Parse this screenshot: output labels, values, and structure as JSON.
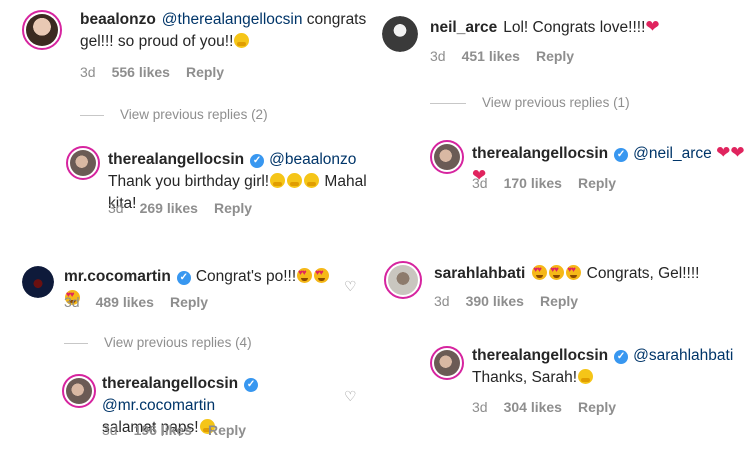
{
  "colors": {
    "mention": "#003569",
    "meta": "#8e8e8e",
    "verified": "#3897f0",
    "heart": "#e0245e"
  },
  "c1": {
    "username": "beaalonzo",
    "mention": "@therealangellocsin",
    "text": " congrats gel!!! so proud of you!!",
    "emoji": "hugging-face",
    "time": "3d",
    "likes": "556 likes",
    "reply": "Reply"
  },
  "vp1": {
    "label": "View previous replies (2)"
  },
  "c2": {
    "username": "therealangellocsin",
    "mention": "@beaalonzo",
    "text": " Thank you birthday girl!",
    "text2": " Mahal kita!",
    "emoji": "hugging-face",
    "time": "3d",
    "likes": "269 likes",
    "reply": "Reply"
  },
  "c3": {
    "username": "neil_arce",
    "text": "Lol! Congrats love!!!!",
    "emoji": "red-heart",
    "time": "3d",
    "likes": "451 likes",
    "reply": "Reply"
  },
  "vp2": {
    "label": "View previous replies (1)"
  },
  "c4": {
    "username": "therealangellocsin",
    "mention": "@neil_arce",
    "emoji": "red-heart",
    "time": "3d",
    "likes": "170 likes",
    "reply": "Reply"
  },
  "c5": {
    "username": "mr.cocomartin",
    "text": "Congrat's po!!!",
    "emoji": "smiling-face-with-heart-eyes",
    "time": "3d",
    "likes": "489 likes",
    "reply": "Reply"
  },
  "vp3": {
    "label": "View previous replies (4)"
  },
  "c6": {
    "username": "therealangellocsin",
    "mention": "@mr.cocomartin",
    "text": "salamat paps!",
    "emoji": "hugging-face",
    "time": "3d",
    "likes": "196 likes",
    "reply": "Reply"
  },
  "c7": {
    "username": "sarahlahbati",
    "text": " Congrats, Gel!!!!",
    "emoji": "smiling-face-with-heart-eyes",
    "time": "3d",
    "likes": "390 likes",
    "reply": "Reply"
  },
  "c8": {
    "username": "therealangellocsin",
    "mention": "@sarahlahbati",
    "text": "Thanks, Sarah!",
    "emoji": "hugging-face",
    "time": "3d",
    "likes": "304 likes",
    "reply": "Reply"
  },
  "icons": {
    "verified": "verified-badge-icon",
    "like": "heart-outline-icon"
  }
}
